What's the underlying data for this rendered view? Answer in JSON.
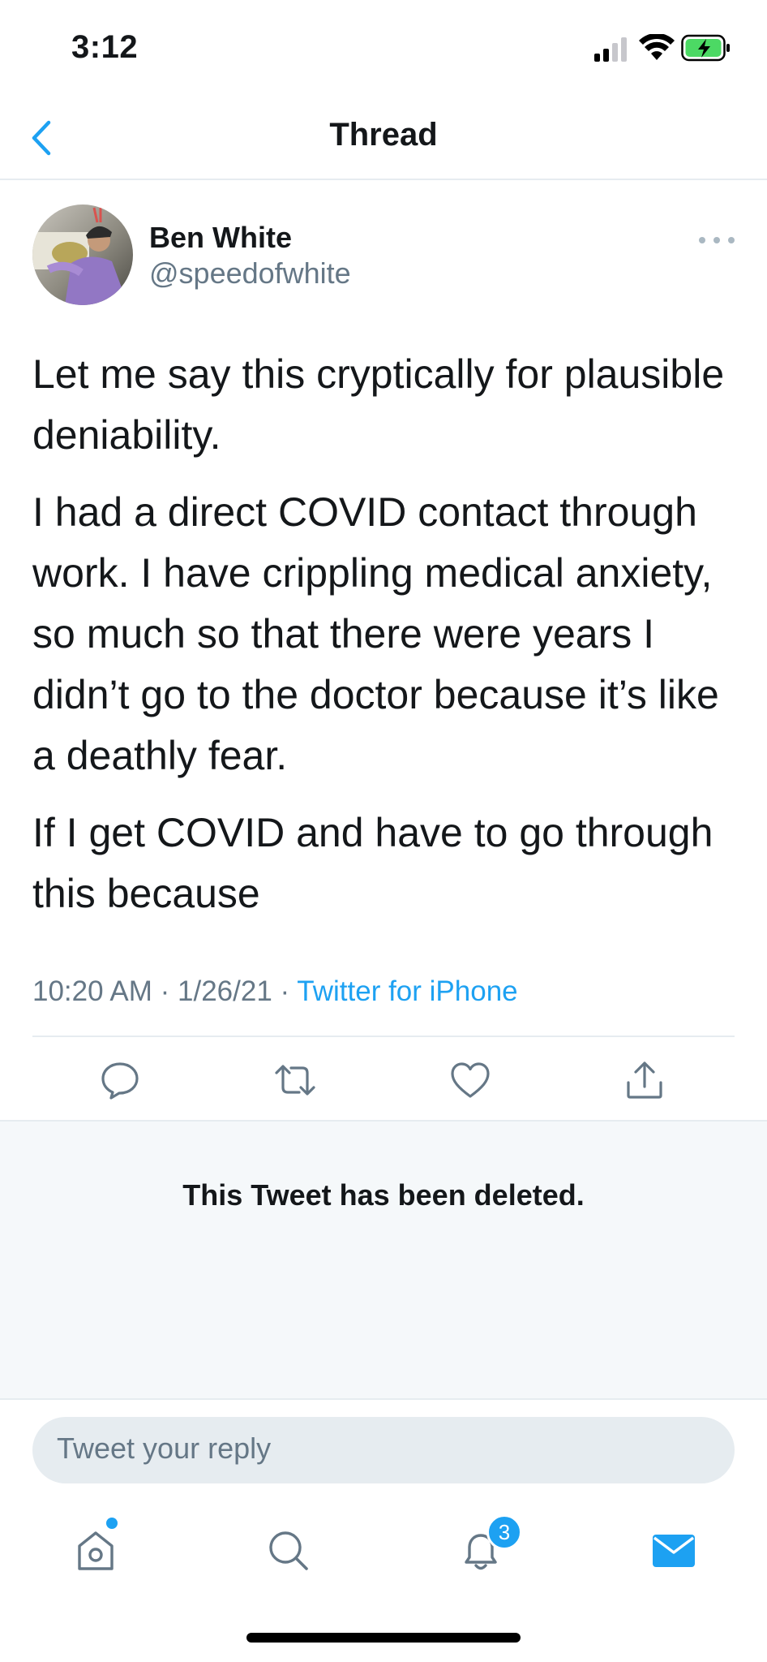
{
  "status_bar": {
    "time": "3:12"
  },
  "header": {
    "title": "Thread"
  },
  "tweet": {
    "author_name": "Ben White",
    "author_handle": "@speedofwhite",
    "paragraphs": [
      "Let me say this cryptically for plausible deniability.",
      "I had a direct COVID contact through work. I have crippling medical anxiety, so much so that there were years I didn’t go to the doctor because it’s like a deathly fear.",
      "If I get COVID and have to go through this because"
    ],
    "time": "10:20 AM",
    "date": "1/26/21",
    "separator": "·",
    "source": "Twitter for iPhone"
  },
  "deleted": {
    "text": "This Tweet has been deleted."
  },
  "reply": {
    "placeholder": "Tweet your reply"
  },
  "tab_bar": {
    "notifications_badge": "3"
  },
  "icons": {
    "back": "chevron-left-icon",
    "more": "more-horizontal-icon",
    "reply": "comment-icon",
    "retweet": "retweet-icon",
    "like": "heart-icon",
    "share": "share-icon",
    "home": "home-icon",
    "search": "search-icon",
    "notifications": "bell-icon",
    "messages": "mail-icon"
  },
  "colors": {
    "accent": "#1da1f2",
    "text": "#14171a",
    "secondary": "#657786",
    "divider": "#e6ecf0"
  }
}
